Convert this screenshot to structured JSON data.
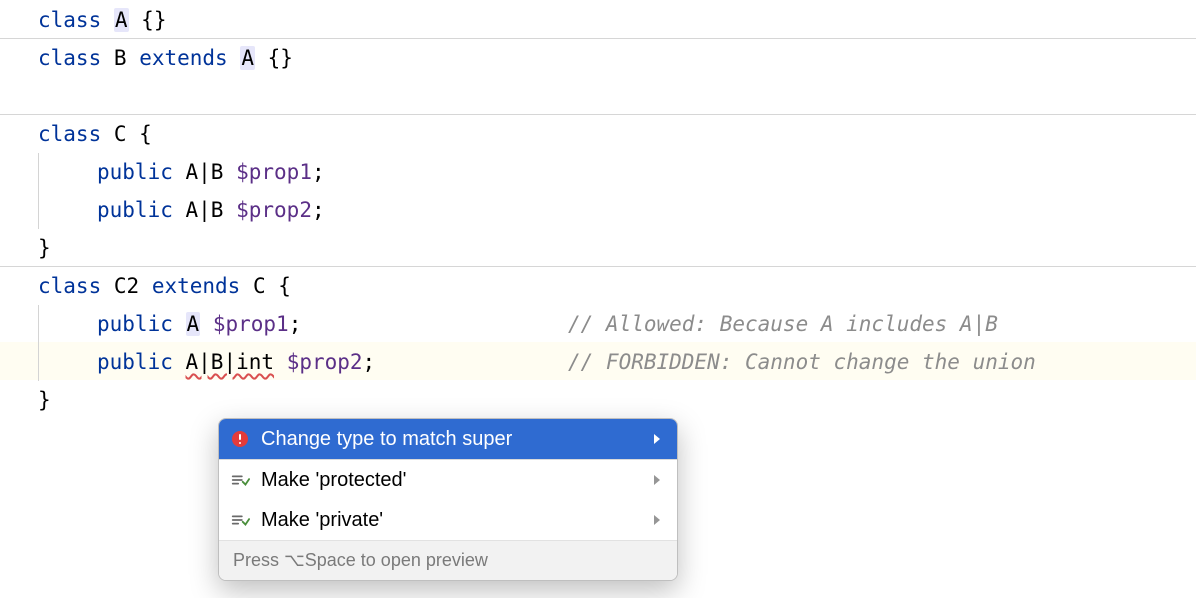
{
  "code": {
    "l1": {
      "kw_class": "class",
      "name": "A",
      "rest": " {}"
    },
    "l2": {
      "kw_class": "class",
      "name": "B",
      "kw_extends": "extends",
      "super": "A",
      "rest": " {}"
    },
    "l4": {
      "kw_class": "class",
      "name": "C",
      "brace": " {"
    },
    "l5": {
      "kw_public": "public",
      "type": "A|B",
      "var": "$prop1",
      "end": ";"
    },
    "l6": {
      "kw_public": "public",
      "type": "A|B",
      "var": "$prop2",
      "end": ";"
    },
    "l7": {
      "brace": "}"
    },
    "l8": {
      "kw_class": "class",
      "name": "C2",
      "kw_extends": "extends",
      "super": "C",
      "brace": " {"
    },
    "l9": {
      "kw_public": "public",
      "type_A": "A",
      "var": "$prop1",
      "end": ";",
      "comment": "// Allowed: Because A includes A|B"
    },
    "l10": {
      "kw_public": "public",
      "type_union": "A|B|int",
      "var": "$prop2",
      "end": ";",
      "comment": "// FORBIDDEN: Cannot change the union"
    },
    "l11": {
      "brace": "}"
    }
  },
  "popover": {
    "item1": "Change type to match super",
    "item2": "Make 'protected'",
    "item3": "Make 'private'",
    "footer": "Press ⌥Space to open preview"
  }
}
